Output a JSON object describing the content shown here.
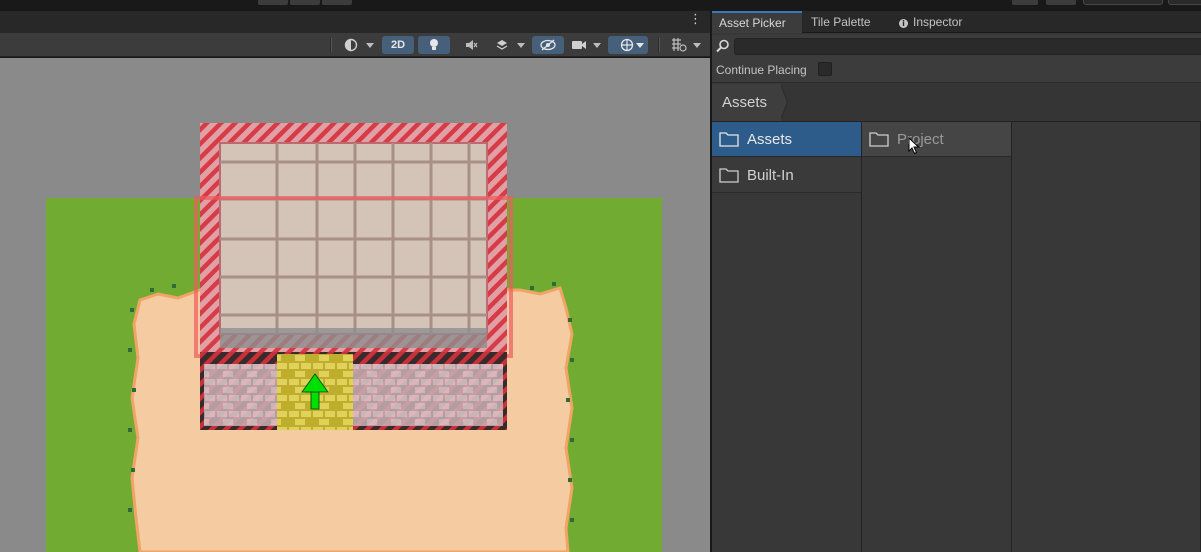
{
  "scene": {
    "toolbar": {
      "btn_2d_label": "2D"
    }
  },
  "panel": {
    "tabs": [
      {
        "label": "Asset Picker",
        "active": true
      },
      {
        "label": "Tile Palette",
        "active": false
      },
      {
        "label": "Inspector",
        "active": false,
        "icon": "info-icon"
      }
    ],
    "search": {
      "value": "",
      "placeholder": ""
    },
    "continue_placing": {
      "label": "Continue Placing",
      "checked": false
    },
    "breadcrumb": "Assets",
    "left_column": [
      {
        "label": "Assets",
        "selected": true
      },
      {
        "label": "Built-In",
        "selected": false
      }
    ],
    "middle_column": [
      {
        "label": "Project",
        "hovered": true
      }
    ]
  },
  "colors": {
    "accent": "#3a79bb",
    "selection": "#2e5c8a",
    "grass": "#72ab32",
    "sand": "#f5cba2",
    "roof": "#d4c3b7",
    "selection_outline": "#e5484d",
    "gizmo_arrow": "#00e000"
  }
}
